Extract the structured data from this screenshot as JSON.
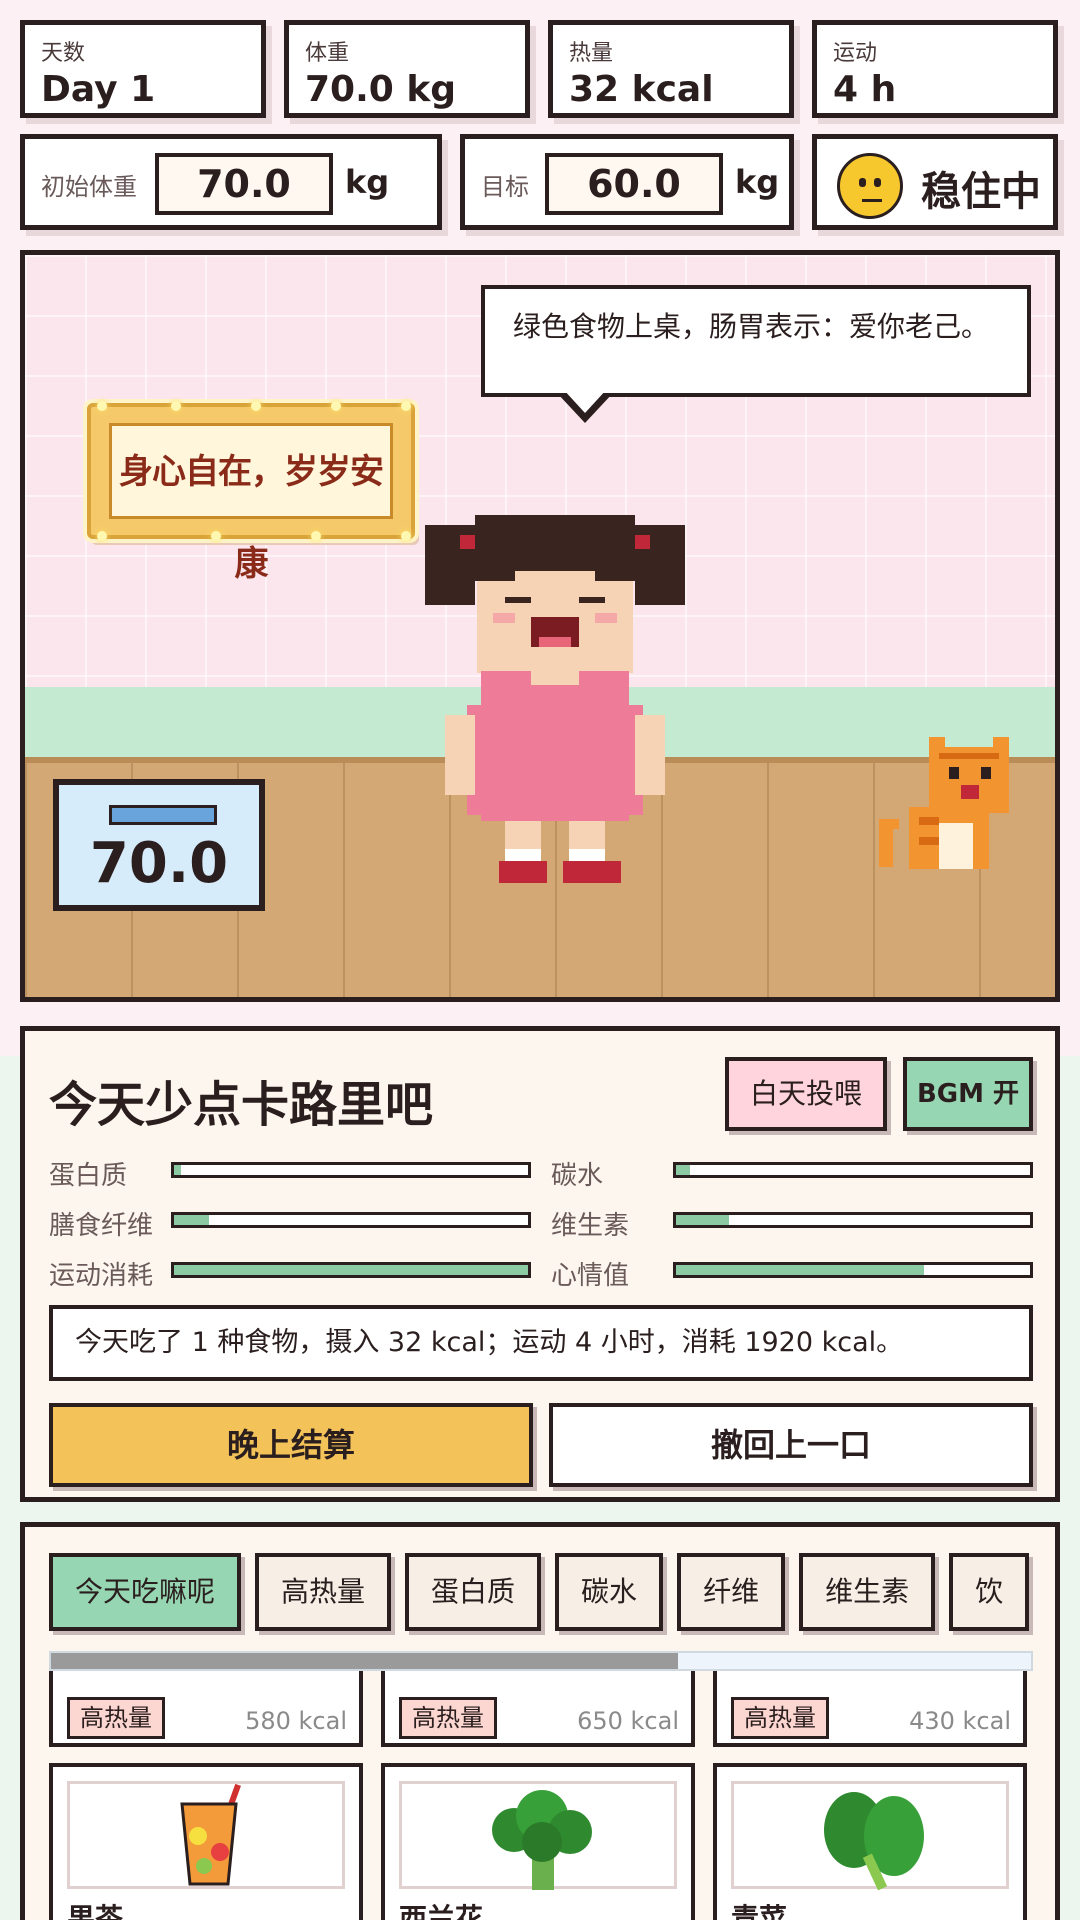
{
  "stats": [
    {
      "label": "天数",
      "value": "Day 1"
    },
    {
      "label": "体重",
      "value": "70.0 kg"
    },
    {
      "label": "热量",
      "value": "32 kcal"
    },
    {
      "label": "运动",
      "value": "4 h"
    }
  ],
  "settings": {
    "start_weight_label": "初始体重",
    "start_weight_value": "70.0",
    "target_label": "目标",
    "target_value": "60.0",
    "unit": "kg",
    "mood_text": "稳住中"
  },
  "scene": {
    "speech": "绿色食物上桌，肠胃表示：爱你老己。",
    "sign_text": "身心自在，岁岁安康",
    "scale_reading": "70.0"
  },
  "panel": {
    "title": "今天少点卡路里吧",
    "feed_button": "白天投喂",
    "bgm_button": "BGM 开",
    "nutrients": [
      {
        "label": "蛋白质",
        "level": 0.02
      },
      {
        "label": "碳水",
        "level": 0.04
      },
      {
        "label": "膳食纤维",
        "level": 0.1
      },
      {
        "label": "维生素",
        "level": 0.15
      },
      {
        "label": "运动消耗",
        "level": 1.0
      },
      {
        "label": "心情值",
        "level": 0.7
      }
    ],
    "summary": "今天吃了 1 种食物，摄入 32 kcal；运动 4 小时，消耗 1920 kcal。",
    "settle_button": "晚上结算",
    "undo_button": "撤回上一口"
  },
  "food": {
    "tabs": [
      "今天吃嘛呢",
      "高热量",
      "蛋白质",
      "碳水",
      "纤维",
      "维生素",
      "饮"
    ],
    "active_tab": 0,
    "scroll_progress": 0.64,
    "top_cards": [
      {
        "tag": "高热量",
        "kcal": "580 kcal"
      },
      {
        "tag": "高热量",
        "kcal": "650 kcal"
      },
      {
        "tag": "高热量",
        "kcal": "430 kcal"
      }
    ],
    "cards": [
      {
        "name": "果茶",
        "icon": "fruit-tea-icon"
      },
      {
        "name": "西兰花",
        "icon": "broccoli-icon"
      },
      {
        "name": "青菜",
        "icon": "greens-icon"
      }
    ]
  },
  "colors": {
    "accent_green": "#96d6b2",
    "accent_yellow": "#f3c35a",
    "accent_pink": "#ffd4dc",
    "outline": "#2a1e1e"
  }
}
